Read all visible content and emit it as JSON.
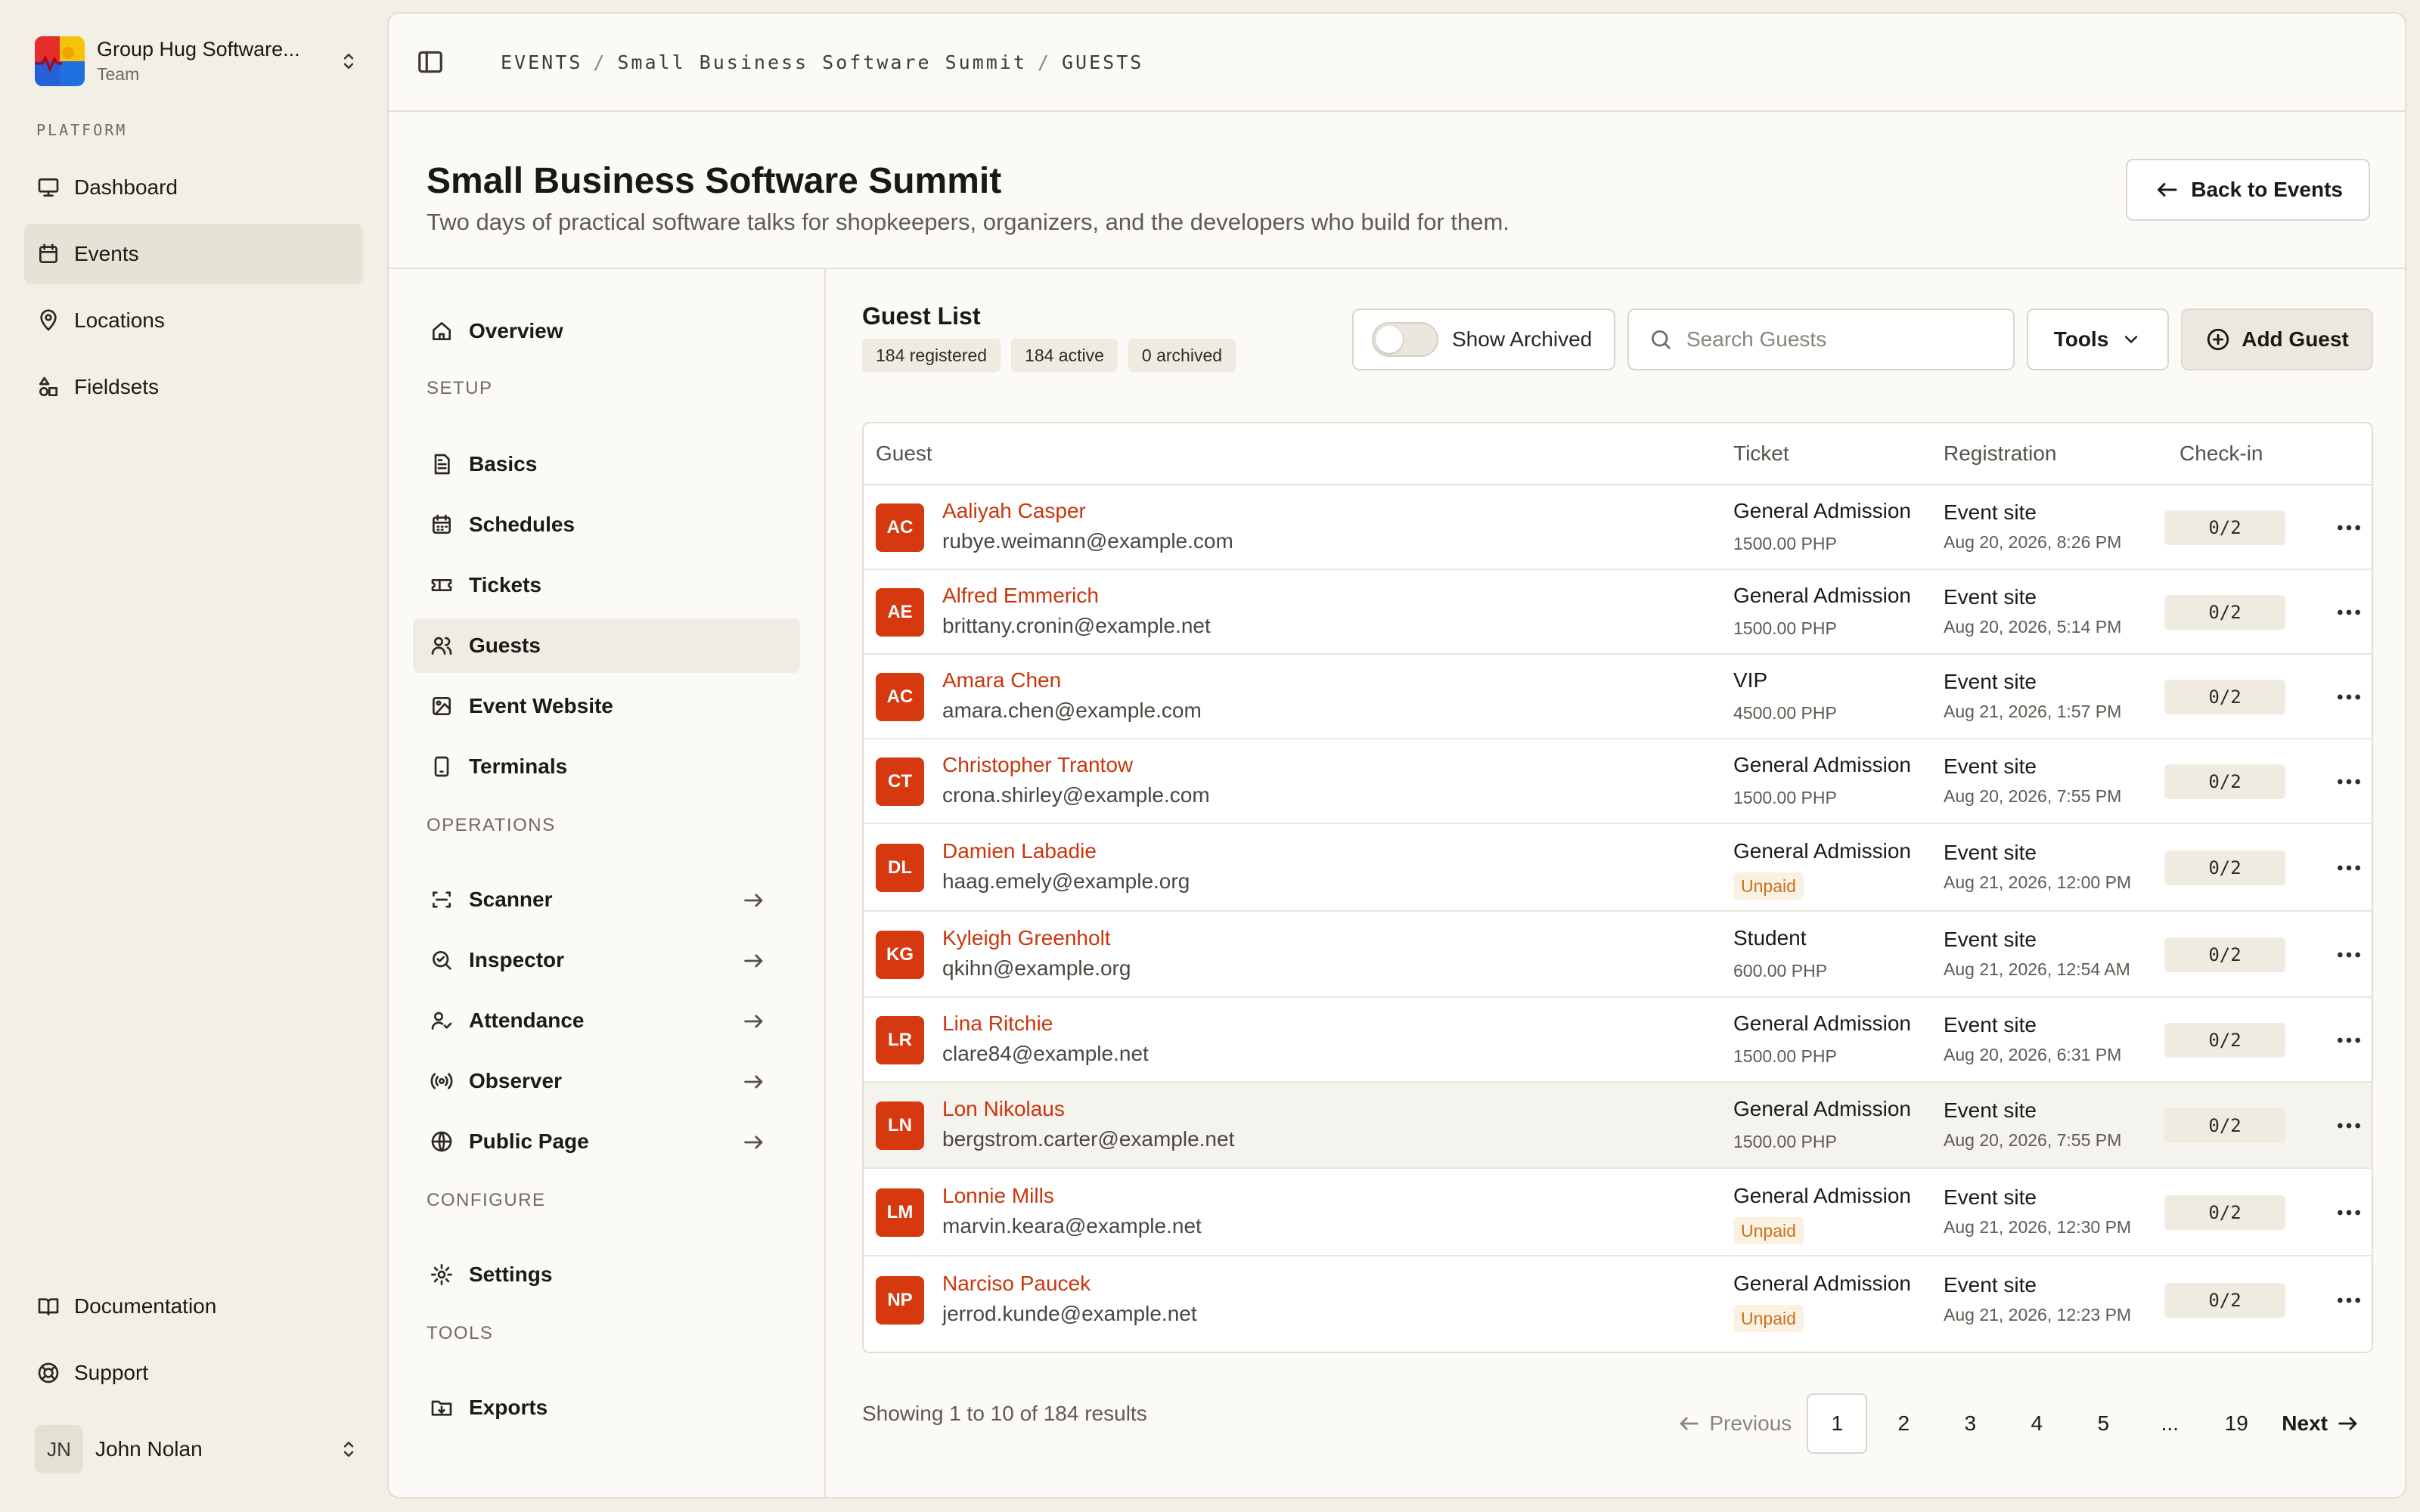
{
  "team": {
    "name": "Group Hug Software...",
    "subtitle": "Team"
  },
  "sidebar": {
    "section_label": "PLATFORM",
    "items": [
      {
        "label": "Dashboard",
        "icon": "monitor-icon"
      },
      {
        "label": "Events",
        "icon": "calendar-icon",
        "active": true
      },
      {
        "label": "Locations",
        "icon": "map-pin-icon"
      },
      {
        "label": "Fieldsets",
        "icon": "shapes-icon"
      }
    ],
    "bottom_items": [
      {
        "label": "Documentation",
        "icon": "book-icon"
      },
      {
        "label": "Support",
        "icon": "lifebuoy-icon"
      }
    ],
    "user": {
      "initials": "JN",
      "name": "John Nolan"
    }
  },
  "breadcrumb": {
    "events": "EVENTS",
    "event": "Small Business Software Summit",
    "current": "GUESTS",
    "separator": "/"
  },
  "header": {
    "title": "Small Business Software Summit",
    "description": "Two days of practical software talks for shopkeepers, organizers, and the developers who build for them.",
    "back_label": "Back to Events"
  },
  "event_nav": {
    "overview": "Overview",
    "setup_label": "SETUP",
    "setup": [
      "Basics",
      "Schedules",
      "Tickets",
      "Guests",
      "Event Website",
      "Terminals"
    ],
    "operations_label": "OPERATIONS",
    "operations": [
      "Scanner",
      "Inspector",
      "Attendance",
      "Observer",
      "Public Page"
    ],
    "configure_label": "CONFIGURE",
    "configure": [
      "Settings"
    ],
    "tools_label": "TOOLS",
    "tools": [
      "Exports"
    ]
  },
  "guest_list": {
    "title": "Guest List",
    "chips": [
      "184 registered",
      "184 active",
      "0 archived"
    ],
    "show_archived_label": "Show Archived",
    "show_archived": false,
    "search_placeholder": "Search Guests",
    "tools_label": "Tools",
    "add_label": "Add Guest",
    "columns": [
      "Guest",
      "Ticket",
      "Registration",
      "Check-in"
    ],
    "rows": [
      {
        "initials": "AC",
        "name": "Aaliyah Casper",
        "email": "rubye.weimann@example.com",
        "ticket": "General Admission",
        "price": "1500.00 PHP",
        "source": "Event site",
        "date": "Aug 20, 2026, 8:26 PM",
        "checkin": "0/2"
      },
      {
        "initials": "AE",
        "name": "Alfred Emmerich",
        "email": "brittany.cronin@example.net",
        "ticket": "General Admission",
        "price": "1500.00 PHP",
        "source": "Event site",
        "date": "Aug 20, 2026, 5:14 PM",
        "checkin": "0/2"
      },
      {
        "initials": "AC",
        "name": "Amara Chen",
        "email": "amara.chen@example.com",
        "ticket": "VIP",
        "price": "4500.00 PHP",
        "source": "Event site",
        "date": "Aug 21, 2026, 1:57 PM",
        "checkin": "0/2"
      },
      {
        "initials": "CT",
        "name": "Christopher Trantow",
        "email": "crona.shirley@example.com",
        "ticket": "General Admission",
        "price": "1500.00 PHP",
        "source": "Event site",
        "date": "Aug 20, 2026, 7:55 PM",
        "checkin": "0/2"
      },
      {
        "initials": "DL",
        "name": "Damien Labadie",
        "email": "haag.emely@example.org",
        "ticket": "General Admission",
        "unpaid": "Unpaid",
        "source": "Event site",
        "date": "Aug 21, 2026, 12:00 PM",
        "checkin": "0/2"
      },
      {
        "initials": "KG",
        "name": "Kyleigh Greenholt",
        "email": "qkihn@example.org",
        "ticket": "Student",
        "price": "600.00 PHP",
        "source": "Event site",
        "date": "Aug 21, 2026, 12:54 AM",
        "checkin": "0/2"
      },
      {
        "initials": "LR",
        "name": "Lina Ritchie",
        "email": "clare84@example.net",
        "ticket": "General Admission",
        "price": "1500.00 PHP",
        "source": "Event site",
        "date": "Aug 20, 2026, 6:31 PM",
        "checkin": "0/2"
      },
      {
        "initials": "LN",
        "name": "Lon Nikolaus",
        "email": "bergstrom.carter@example.net",
        "ticket": "General Admission",
        "price": "1500.00 PHP",
        "source": "Event site",
        "date": "Aug 20, 2026, 7:55 PM",
        "checkin": "0/2"
      },
      {
        "initials": "LM",
        "name": "Lonnie Mills",
        "email": "marvin.keara@example.net",
        "ticket": "General Admission",
        "unpaid": "Unpaid",
        "source": "Event site",
        "date": "Aug 21, 2026, 12:30 PM",
        "checkin": "0/2"
      },
      {
        "initials": "NP",
        "name": "Narciso Paucek",
        "email": "jerrod.kunde@example.net",
        "ticket": "General Admission",
        "unpaid": "Unpaid",
        "source": "Event site",
        "date": "Aug 21, 2026, 12:23 PM",
        "checkin": "0/2"
      }
    ],
    "highlighted_row": 7,
    "pagination": {
      "info": "Showing 1 to 10 of 184 results",
      "previous": "Previous",
      "next": "Next",
      "pages": [
        "1",
        "2",
        "3",
        "4",
        "5",
        "...",
        "19"
      ],
      "current": "1"
    }
  },
  "colors": {
    "accent": "#d6390f",
    "background": "#f2efe7",
    "unpaid": "#c7731c"
  }
}
